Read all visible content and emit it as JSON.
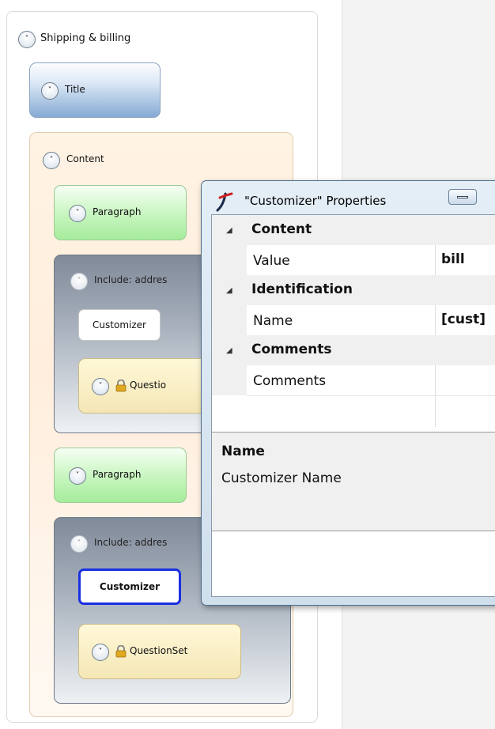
{
  "tree": {
    "root_label": "Shipping & billing",
    "title_label": "Title",
    "content_label": "Content",
    "paragraph1_label": "Paragraph",
    "include1_label": "Include: addres",
    "customizer1_label": "Customizer",
    "questionset1_label": "Questio",
    "paragraph2_label": "Paragraph",
    "include2_label": "Include: addres",
    "customizer2_label": "Customizer",
    "questionset2_label": "QuestionSet"
  },
  "properties": {
    "window_title": "\"Customizer\" Properties",
    "categories": [
      {
        "name": "Content",
        "rows": [
          {
            "name": "Value",
            "value": "bill"
          }
        ]
      },
      {
        "name": "Identification",
        "rows": [
          {
            "name": "Name",
            "value": "[cust]"
          }
        ]
      },
      {
        "name": "Comments",
        "rows": [
          {
            "name": "Comments",
            "value": ""
          }
        ]
      }
    ],
    "description": {
      "title": "Name",
      "text": "Customizer Name"
    }
  },
  "icons": {
    "expanded": "chevron-up-icon",
    "collapsed": "chevron-down-icon",
    "lock": "lock-icon",
    "app": "app-logo-icon",
    "category": "collapse-triangle-icon"
  },
  "colors": {
    "selection_border": "#1a2fe0",
    "title_block": "#86aad4",
    "content_block": "#ffeedd",
    "paragraph_block": "#a6ec9c",
    "include_block": "#808a99",
    "questionset_block": "#f4e6b6"
  }
}
